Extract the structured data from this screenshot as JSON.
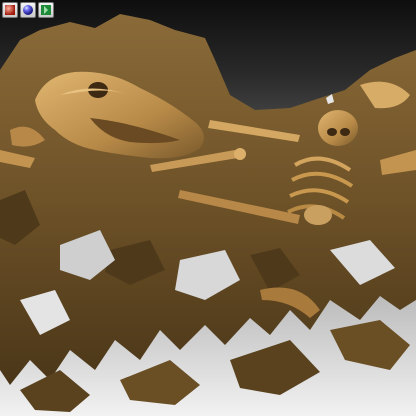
{
  "toolbar": {
    "buttons": [
      {
        "name": "shading-mode-button",
        "icon": "red-shaded-sphere-icon",
        "color": "#c0392b"
      },
      {
        "name": "material-mode-button",
        "icon": "blue-glossy-sphere-icon",
        "color": "#3a3ac8"
      },
      {
        "name": "panel-toggle-button",
        "icon": "green-panel-icon",
        "color": "#1f8a3a"
      }
    ]
  },
  "viewport": {
    "background_top": "#0e0e0e",
    "background_bottom": "#f2f2f2",
    "model_color": "#8a6a3a",
    "model_highlight": "#d2a45e",
    "model_shadow": "#3a2a14"
  }
}
